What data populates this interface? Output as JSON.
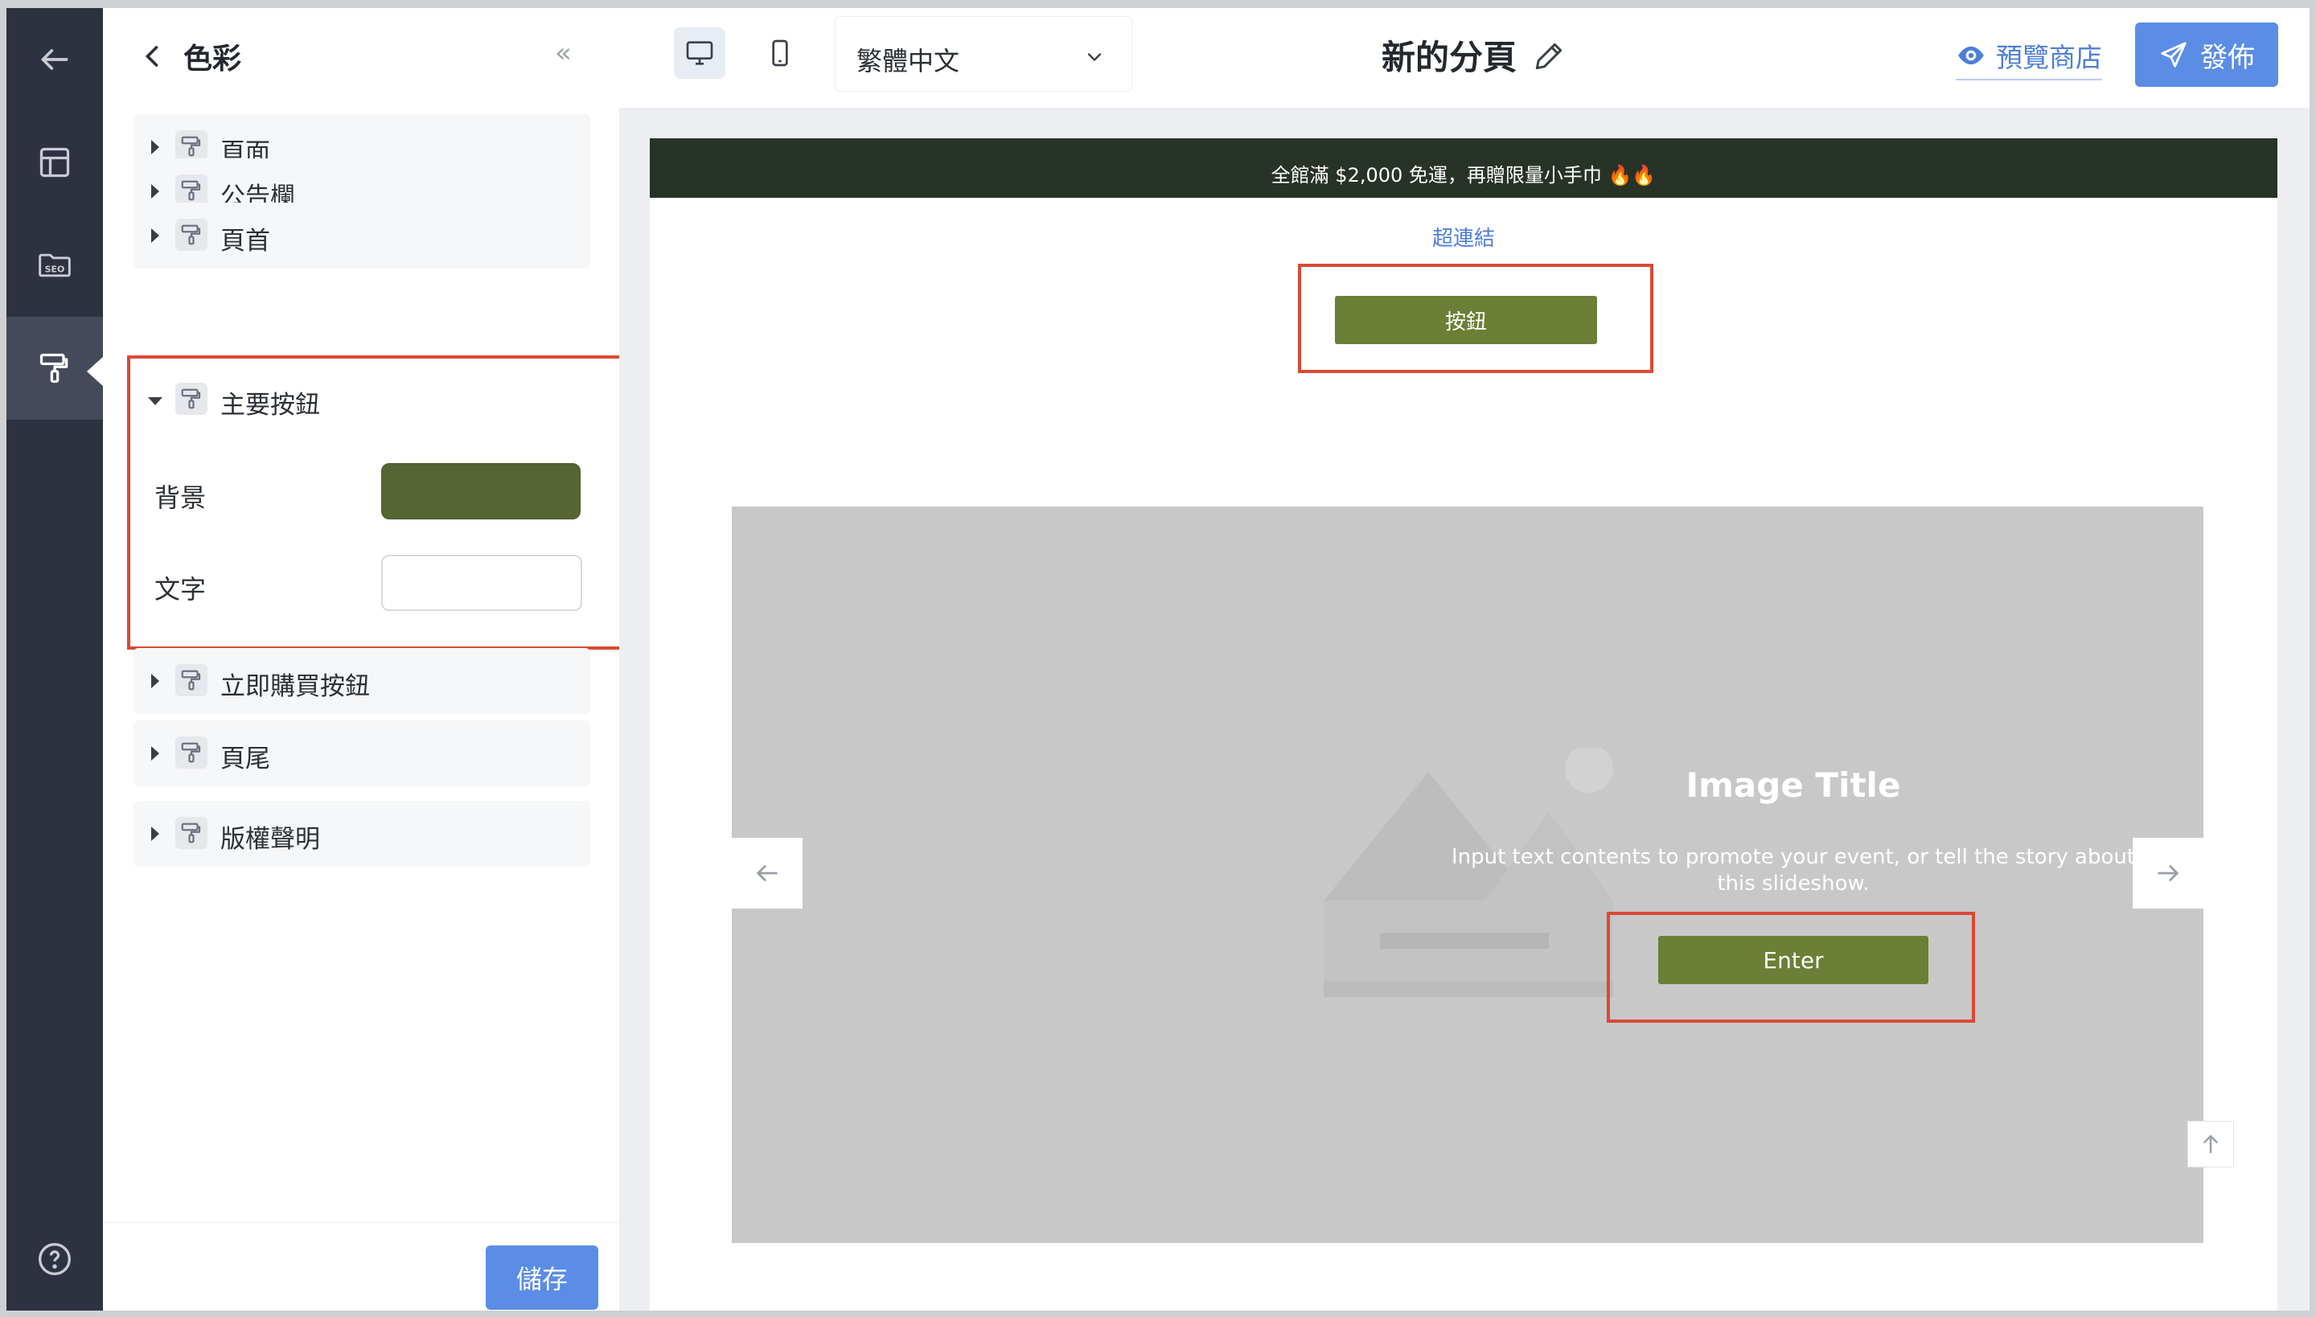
{
  "sidebar_panel": {
    "title": "色彩",
    "sections": [
      {
        "label": "頁面"
      },
      {
        "label": "公告欄"
      },
      {
        "label": "頁首"
      },
      {
        "label": "主要按鈕"
      },
      {
        "label": "立即購買按鈕"
      },
      {
        "label": "頁尾"
      },
      {
        "label": "版權聲明"
      }
    ],
    "primary_button": {
      "background_label": "背景",
      "text_label": "文字",
      "background_color": "#556632",
      "text_color": "#ffffff"
    },
    "save_label": "儲存"
  },
  "toolbar": {
    "language": "繁體中文",
    "page_title": "新的分頁",
    "preview_label": "預覽商店",
    "publish_label": "發佈"
  },
  "site": {
    "announcement": "全館滿 $2,000 免運，再贈限量小手巾 🔥🔥",
    "hyperlink": "超連結",
    "button_label": "按鈕",
    "slide": {
      "title": "Image Title",
      "text": "Input text contents to promote your event, or tell the story about this slideshow.",
      "button_label": "Enter"
    }
  },
  "colors": {
    "accent": "#5b8de6",
    "brand_green": "#6b7f36",
    "announcement_bg": "#283328",
    "highlight": "#d94a35"
  }
}
